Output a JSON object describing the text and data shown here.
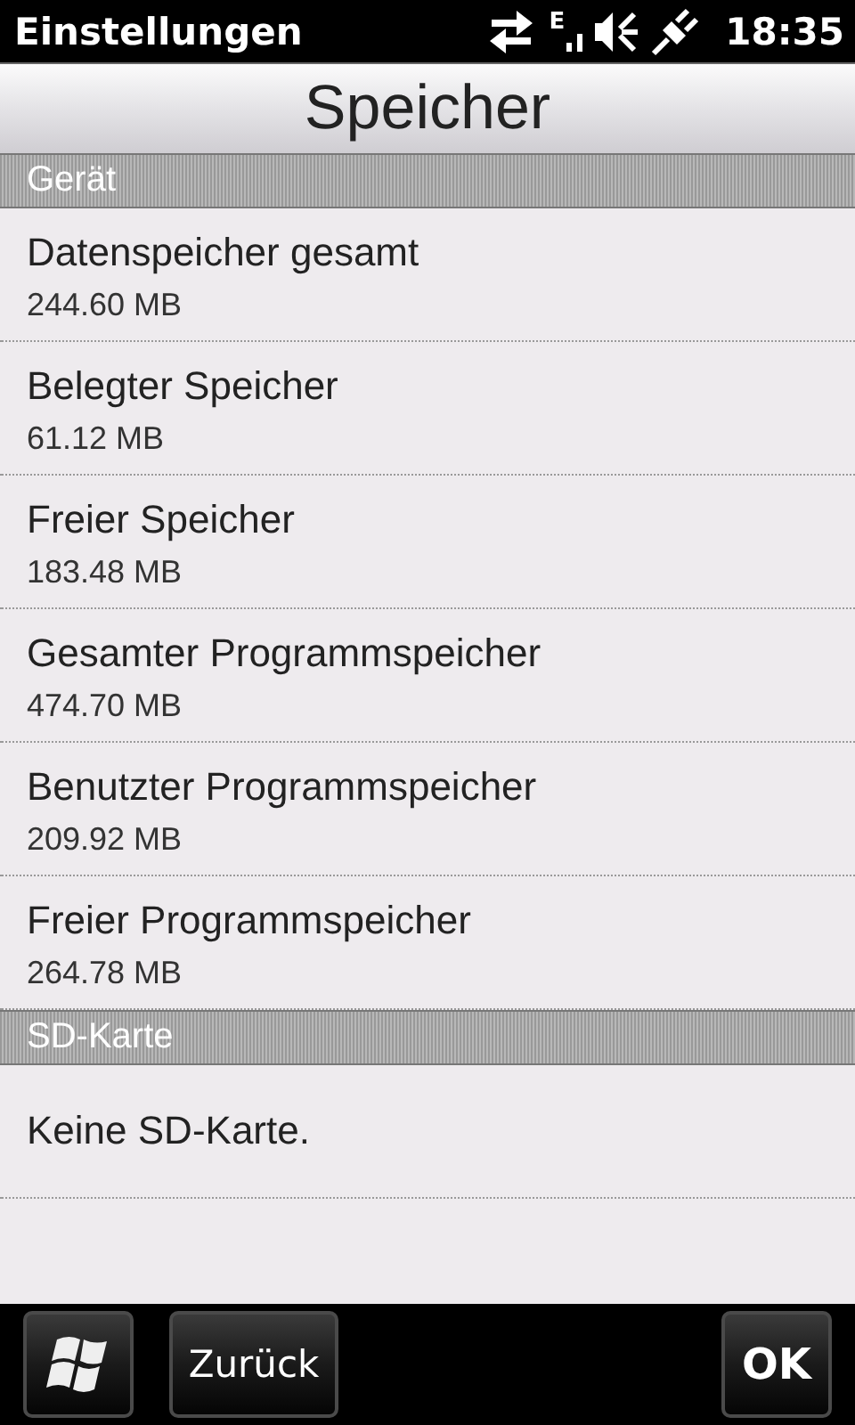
{
  "status_bar": {
    "title": "Einstellungen",
    "network_type": "E",
    "time": "18:35"
  },
  "header": {
    "title": "Speicher"
  },
  "sections": [
    {
      "title": "Gerät",
      "items": [
        {
          "label": "Datenspeicher gesamt",
          "value": "244.60 MB"
        },
        {
          "label": "Belegter Speicher",
          "value": "61.12 MB"
        },
        {
          "label": "Freier Speicher",
          "value": "183.48 MB"
        },
        {
          "label": "Gesamter Programmspeicher",
          "value": "474.70 MB"
        },
        {
          "label": "Benutzter Programmspeicher",
          "value": "209.92 MB"
        },
        {
          "label": "Freier Programmspeicher",
          "value": "264.78 MB"
        }
      ]
    },
    {
      "title": "SD-Karte",
      "items": [
        {
          "label": "Keine SD-Karte."
        }
      ]
    }
  ],
  "softkeys": {
    "back": "Zurück",
    "ok": "OK"
  }
}
